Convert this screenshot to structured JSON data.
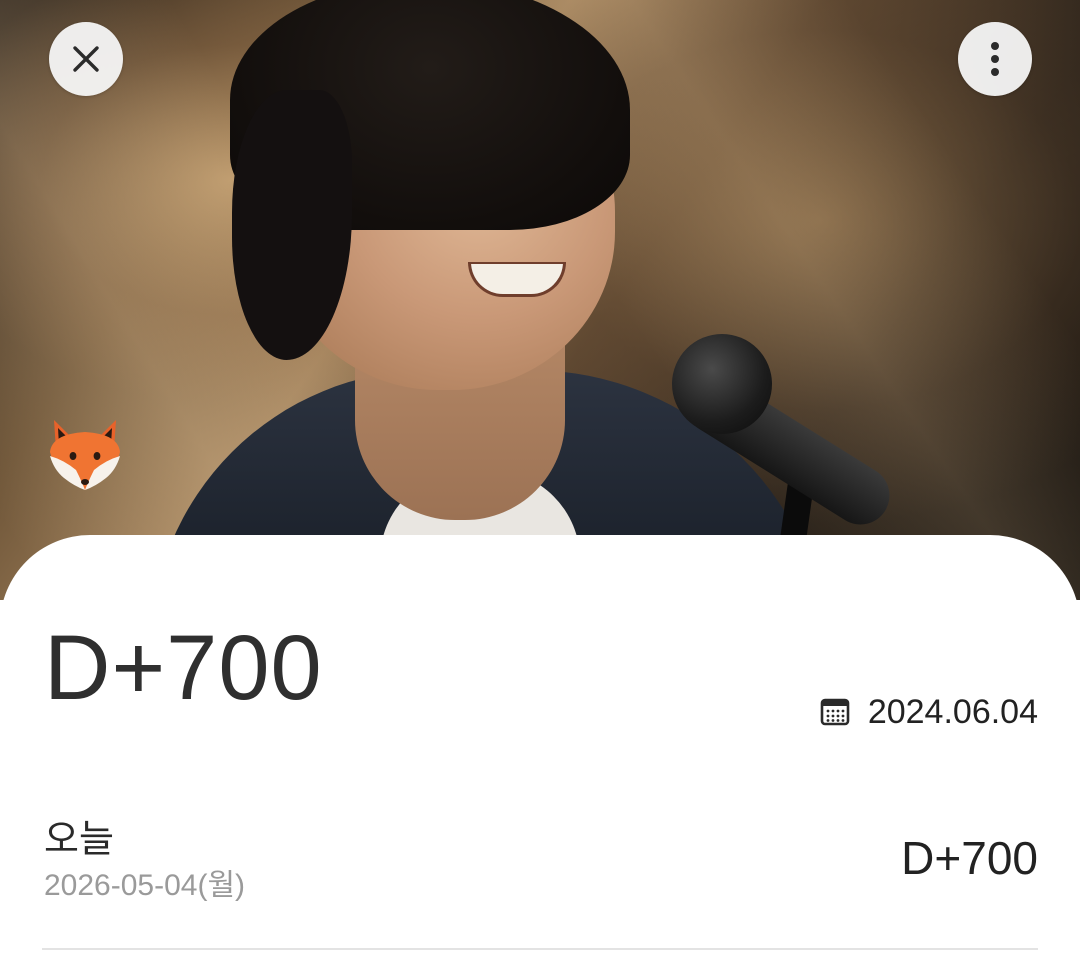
{
  "header": {
    "close_icon": "close-icon",
    "more_icon": "more-vert-icon"
  },
  "hero": {
    "badge_icon": "fox-icon"
  },
  "sheet": {
    "dday_main": "D+700",
    "start_date_icon": "calendar-icon",
    "start_date": "2024.06.04",
    "today": {
      "label": "오늘",
      "date": "2026-05-04(월)",
      "dday": "D+700"
    }
  }
}
